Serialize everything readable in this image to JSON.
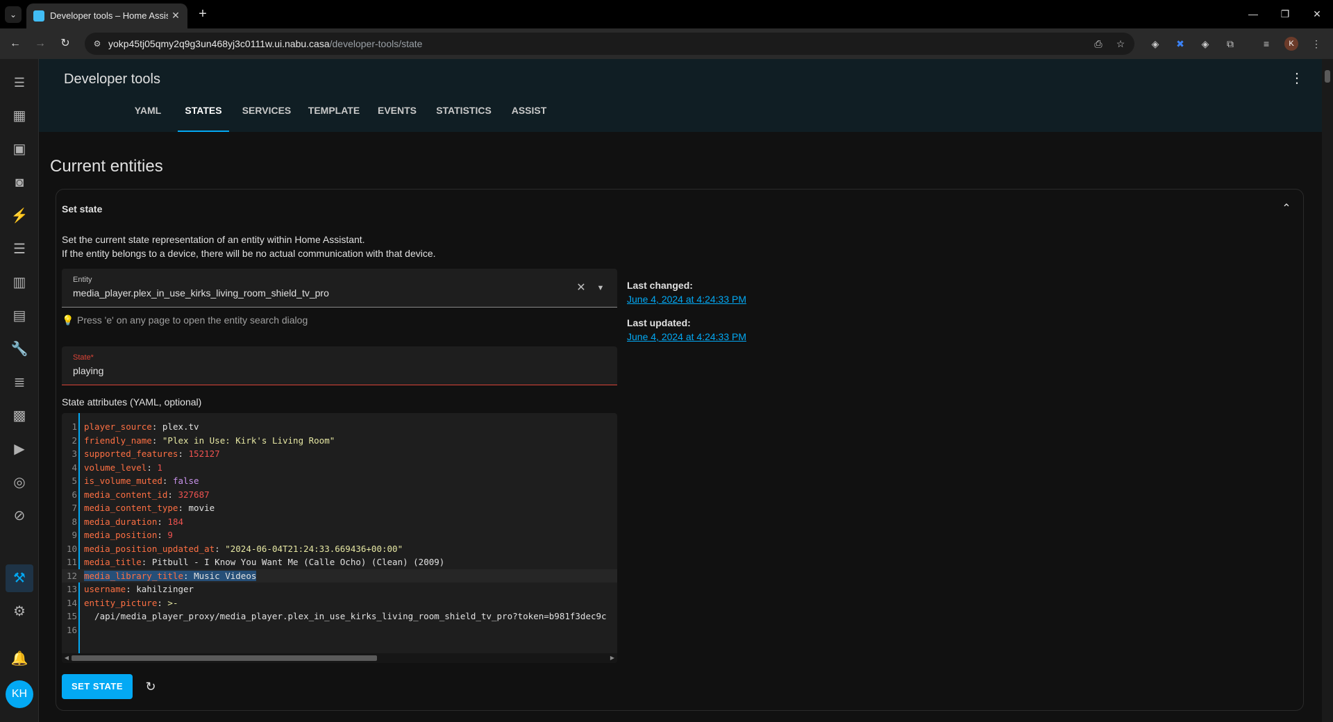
{
  "browser": {
    "tab_title": "Developer tools – Home Assista",
    "url_host": "yokp45tj05qmy2q9g3un468yj3c0111w.ui.nabu.casa",
    "url_path": "/developer-tools/state",
    "profile_initial": "K"
  },
  "sidebar": {
    "items": [
      {
        "icon": "dashboard-icon",
        "glyph": "▦"
      },
      {
        "icon": "energy-icon",
        "glyph": "▣"
      },
      {
        "icon": "map-icon",
        "glyph": "◙"
      },
      {
        "icon": "lightning-icon",
        "glyph": "⚡"
      },
      {
        "icon": "list-icon",
        "glyph": "☰"
      },
      {
        "icon": "history-icon",
        "glyph": "▥"
      },
      {
        "icon": "calendar-icon",
        "glyph": "▤"
      },
      {
        "icon": "wrench-icon",
        "glyph": "🔧"
      },
      {
        "icon": "logbook-icon",
        "glyph": "≣"
      },
      {
        "icon": "hacs-icon",
        "glyph": "▩"
      },
      {
        "icon": "media-icon",
        "glyph": "▶"
      },
      {
        "icon": "remote-icon",
        "glyph": "◎"
      },
      {
        "icon": "compass-icon",
        "glyph": "⊘"
      }
    ],
    "avatar_initials": "KH"
  },
  "header": {
    "title": "Developer tools",
    "tabs": [
      {
        "label": "YAML",
        "active": false
      },
      {
        "label": "STATES",
        "active": true
      },
      {
        "label": "SERVICES",
        "active": false
      },
      {
        "label": "TEMPLATE",
        "active": false
      },
      {
        "label": "EVENTS",
        "active": false
      },
      {
        "label": "STATISTICS",
        "active": false
      },
      {
        "label": "ASSIST",
        "active": false
      }
    ]
  },
  "main": {
    "heading": "Current entities",
    "card_title": "Set state",
    "description_line1": "Set the current state representation of an entity within Home Assistant.",
    "description_line2": "If the entity belongs to a device, there will be no actual communication with that device.",
    "entity_label": "Entity",
    "entity_value": "media_player.plex_in_use_kirks_living_room_shield_tv_pro",
    "hint": "Press 'e' on any page to open the entity search dialog",
    "state_label": "State*",
    "state_value": "playing",
    "attributes_label": "State attributes (YAML, optional)",
    "set_state_button": "SET STATE",
    "last_changed_label": "Last changed:",
    "last_changed_value": "June 4, 2024 at 4:24:33 PM",
    "last_updated_label": "Last updated:",
    "last_updated_value": "June 4, 2024 at 4:24:33 PM"
  },
  "yaml_lines": [
    {
      "n": "1",
      "key": "player_source",
      "val": "plex.tv",
      "type": "p"
    },
    {
      "n": "2",
      "key": "friendly_name",
      "val": "\"Plex in Use: Kirk's Living Room\"",
      "type": "s"
    },
    {
      "n": "3",
      "key": "supported_features",
      "val": "152127",
      "type": "n"
    },
    {
      "n": "4",
      "key": "volume_level",
      "val": "1",
      "type": "n"
    },
    {
      "n": "5",
      "key": "is_volume_muted",
      "val": "false",
      "type": "b"
    },
    {
      "n": "6",
      "key": "media_content_id",
      "val": "327687",
      "type": "n"
    },
    {
      "n": "7",
      "key": "media_content_type",
      "val": "movie",
      "type": "p"
    },
    {
      "n": "8",
      "key": "media_duration",
      "val": "184",
      "type": "n"
    },
    {
      "n": "9",
      "key": "media_position",
      "val": "9",
      "type": "n"
    },
    {
      "n": "10",
      "key": "media_position_updated_at",
      "val": "\"2024-06-04T21:24:33.669436+00:00\"",
      "type": "s"
    },
    {
      "n": "11",
      "key": "media_title",
      "val": "Pitbull - I Know You Want Me (Calle Ocho) (Clean) (2009)",
      "type": "p"
    },
    {
      "n": "12",
      "key": "media_library_title",
      "val": "Music Videos",
      "type": "p"
    },
    {
      "n": "13",
      "key": "username",
      "val": "kahilzinger",
      "type": "p"
    },
    {
      "n": "14",
      "key": "entity_picture",
      "val": ">-",
      "type": "s"
    },
    {
      "n": "15",
      "key": "",
      "val": "  /api/media_player_proxy/media_player.plex_in_use_kirks_living_room_shield_tv_pro?token=b981f3dec9c",
      "type": "p"
    },
    {
      "n": "16",
      "key": "",
      "val": "",
      "type": "p"
    }
  ]
}
